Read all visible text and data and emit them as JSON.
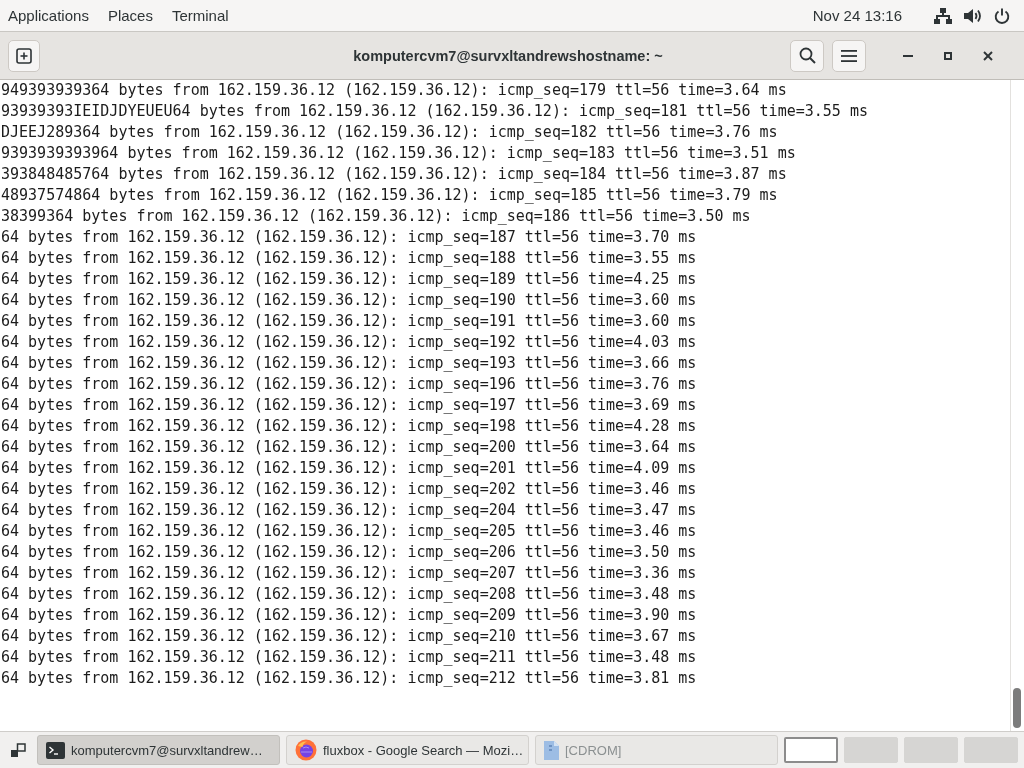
{
  "top_bar": {
    "menus": [
      "Applications",
      "Places",
      "Terminal"
    ],
    "clock": "Nov 24 13:16"
  },
  "window": {
    "title": "komputercvm7@survxltandrewshostname: ~"
  },
  "terminal": {
    "lines": [
      "949393939364 bytes from 162.159.36.12 (162.159.36.12): icmp_seq=179 ttl=56 time=3.64 ms",
      "93939393IEIDJDYEUEU64 bytes from 162.159.36.12 (162.159.36.12): icmp_seq=181 ttl=56 time=3.55 ms",
      "DJEEJ289364 bytes from 162.159.36.12 (162.159.36.12): icmp_seq=182 ttl=56 time=3.76 ms",
      "9393939393964 bytes from 162.159.36.12 (162.159.36.12): icmp_seq=183 ttl=56 time=3.51 ms",
      "393848485764 bytes from 162.159.36.12 (162.159.36.12): icmp_seq=184 ttl=56 time=3.87 ms",
      "48937574864 bytes from 162.159.36.12 (162.159.36.12): icmp_seq=185 ttl=56 time=3.79 ms",
      "38399364 bytes from 162.159.36.12 (162.159.36.12): icmp_seq=186 ttl=56 time=3.50 ms",
      "64 bytes from 162.159.36.12 (162.159.36.12): icmp_seq=187 ttl=56 time=3.70 ms",
      "64 bytes from 162.159.36.12 (162.159.36.12): icmp_seq=188 ttl=56 time=3.55 ms",
      "64 bytes from 162.159.36.12 (162.159.36.12): icmp_seq=189 ttl=56 time=4.25 ms",
      "64 bytes from 162.159.36.12 (162.159.36.12): icmp_seq=190 ttl=56 time=3.60 ms",
      "64 bytes from 162.159.36.12 (162.159.36.12): icmp_seq=191 ttl=56 time=3.60 ms",
      "64 bytes from 162.159.36.12 (162.159.36.12): icmp_seq=192 ttl=56 time=4.03 ms",
      "64 bytes from 162.159.36.12 (162.159.36.12): icmp_seq=193 ttl=56 time=3.66 ms",
      "64 bytes from 162.159.36.12 (162.159.36.12): icmp_seq=196 ttl=56 time=3.76 ms",
      "64 bytes from 162.159.36.12 (162.159.36.12): icmp_seq=197 ttl=56 time=3.69 ms",
      "64 bytes from 162.159.36.12 (162.159.36.12): icmp_seq=198 ttl=56 time=4.28 ms",
      "64 bytes from 162.159.36.12 (162.159.36.12): icmp_seq=200 ttl=56 time=3.64 ms",
      "64 bytes from 162.159.36.12 (162.159.36.12): icmp_seq=201 ttl=56 time=4.09 ms",
      "64 bytes from 162.159.36.12 (162.159.36.12): icmp_seq=202 ttl=56 time=3.46 ms",
      "64 bytes from 162.159.36.12 (162.159.36.12): icmp_seq=204 ttl=56 time=3.47 ms",
      "64 bytes from 162.159.36.12 (162.159.36.12): icmp_seq=205 ttl=56 time=3.46 ms",
      "64 bytes from 162.159.36.12 (162.159.36.12): icmp_seq=206 ttl=56 time=3.50 ms",
      "64 bytes from 162.159.36.12 (162.159.36.12): icmp_seq=207 ttl=56 time=3.36 ms",
      "64 bytes from 162.159.36.12 (162.159.36.12): icmp_seq=208 ttl=56 time=3.48 ms",
      "64 bytes from 162.159.36.12 (162.159.36.12): icmp_seq=209 ttl=56 time=3.90 ms",
      "64 bytes from 162.159.36.12 (162.159.36.12): icmp_seq=210 ttl=56 time=3.67 ms",
      "64 bytes from 162.159.36.12 (162.159.36.12): icmp_seq=211 ttl=56 time=3.48 ms",
      "64 bytes from 162.159.36.12 (162.159.36.12): icmp_seq=212 ttl=56 time=3.81 ms"
    ]
  },
  "taskbar": {
    "tasks": [
      {
        "kind": "terminal",
        "label": "komputercvm7@survxltandrew…",
        "selected": true,
        "minimized": false
      },
      {
        "kind": "browser",
        "label": "fluxbox - Google Search — Mozi…",
        "selected": false,
        "minimized": false
      },
      {
        "kind": "drive",
        "label": "[CDROM]",
        "selected": false,
        "minimized": true
      }
    ],
    "workspaces": [
      {
        "selected": true
      },
      {
        "selected": false
      },
      {
        "selected": false
      },
      {
        "selected": false
      }
    ]
  }
}
